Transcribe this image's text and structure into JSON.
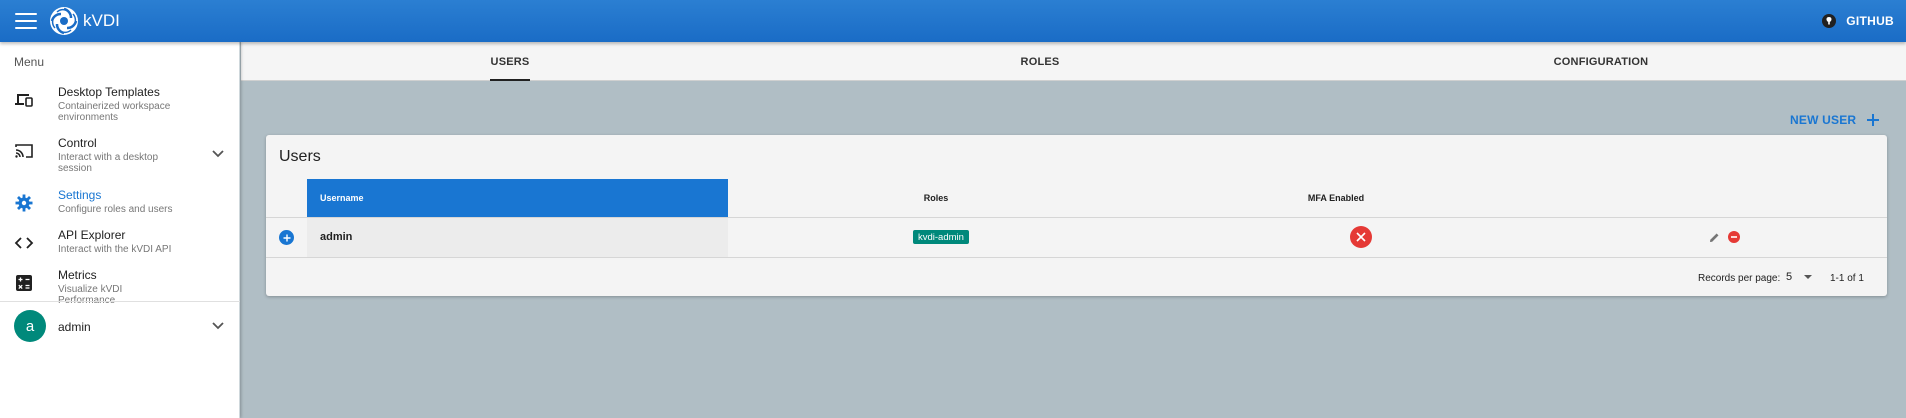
{
  "app": {
    "title": "kVDI",
    "github_label": "GITHUB"
  },
  "drawer": {
    "title": "Menu",
    "items": [
      {
        "label": "Desktop Templates",
        "subtitle": "Containerized workspace environments",
        "icon": "devices-icon"
      },
      {
        "label": "Control",
        "subtitle": "Interact with a desktop session",
        "icon": "cast-icon"
      },
      {
        "label": "Settings",
        "subtitle": "Configure roles and users",
        "icon": "gear-icon"
      },
      {
        "label": "API Explorer",
        "subtitle": "Interact with the kVDI API",
        "icon": "code-icon"
      },
      {
        "label": "Metrics",
        "subtitle": "Visualize kVDI Performance",
        "icon": "calculator-icon"
      }
    ],
    "user": {
      "initial": "a",
      "name": "admin"
    }
  },
  "tabs": [
    {
      "label": "USERS",
      "active": true
    },
    {
      "label": "ROLES",
      "active": false
    },
    {
      "label": "CONFIGURATION",
      "active": false
    }
  ],
  "main": {
    "new_user_label": "NEW USER",
    "card_title": "Users",
    "columns": [
      "Username",
      "Roles",
      "MFA Enabled"
    ],
    "rows": [
      {
        "username": "admin",
        "role": "kvdi-admin",
        "mfa_enabled": false
      }
    ],
    "footer": {
      "records_label": "Records per page:",
      "per_page": "5",
      "range": "1-1 of 1"
    }
  },
  "colors": {
    "primary": "#1976d2",
    "background": "#b0bec5",
    "chip": "#00897b",
    "mfa_off": "#e53935",
    "delete": "#e53935"
  }
}
